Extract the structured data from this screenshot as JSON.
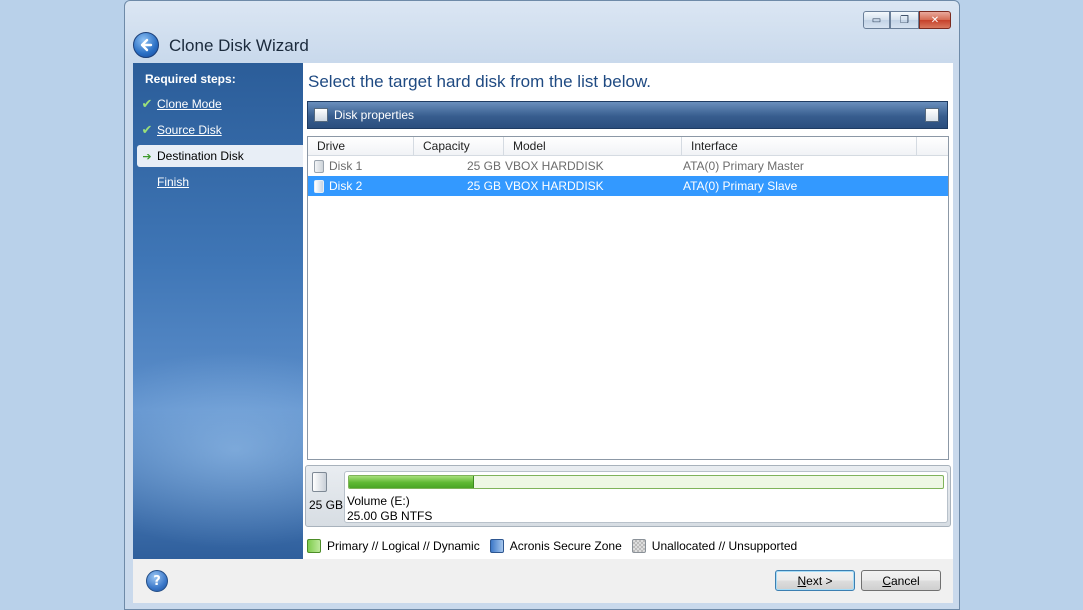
{
  "window": {
    "title": "Clone Disk Wizard",
    "controls": {
      "minimize": "▭",
      "maximize": "❐",
      "close": "✕"
    }
  },
  "sidebar": {
    "heading": "Required steps:",
    "steps": [
      {
        "label": "Clone Mode",
        "state": "done",
        "mark": "✔"
      },
      {
        "label": "Source Disk",
        "state": "done",
        "mark": "✔"
      },
      {
        "label": "Destination Disk",
        "state": "current",
        "mark": "➔"
      },
      {
        "label": "Finish",
        "state": "pending",
        "mark": ""
      }
    ]
  },
  "main": {
    "heading": "Select the target hard disk from the list below.",
    "properties_label": "Disk properties",
    "columns": [
      "Drive",
      "Capacity",
      "Model",
      "Interface"
    ],
    "rows": [
      {
        "drive": "Disk 1",
        "capacity": "25 GB",
        "model": "VBOX HARDDISK",
        "interface": "ATA(0) Primary Master",
        "selected": false
      },
      {
        "drive": "Disk 2",
        "capacity": "25 GB",
        "model": "VBOX HARDDISK",
        "interface": "ATA(0) Primary Slave",
        "selected": true
      }
    ],
    "disk_map": {
      "size": "25 GB",
      "volume_name": "Volume (E:)",
      "volume_info": "25.00 GB  NTFS",
      "used_fraction": 0.21
    },
    "legend": [
      {
        "label": "Primary // Logical // Dynamic",
        "swatch": "primary"
      },
      {
        "label": "Acronis Secure Zone",
        "swatch": "secure"
      },
      {
        "label": "Unallocated // Unsupported",
        "swatch": "unalloc"
      }
    ]
  },
  "footer": {
    "help": "?",
    "next_label_accel": "N",
    "next_label_rest": "ext >",
    "cancel_label_accel": "C",
    "cancel_label_rest": "ancel"
  },
  "colors": {
    "selection": "#3399ff",
    "heading": "#1f4a82",
    "accent_green": "#5fb833"
  }
}
